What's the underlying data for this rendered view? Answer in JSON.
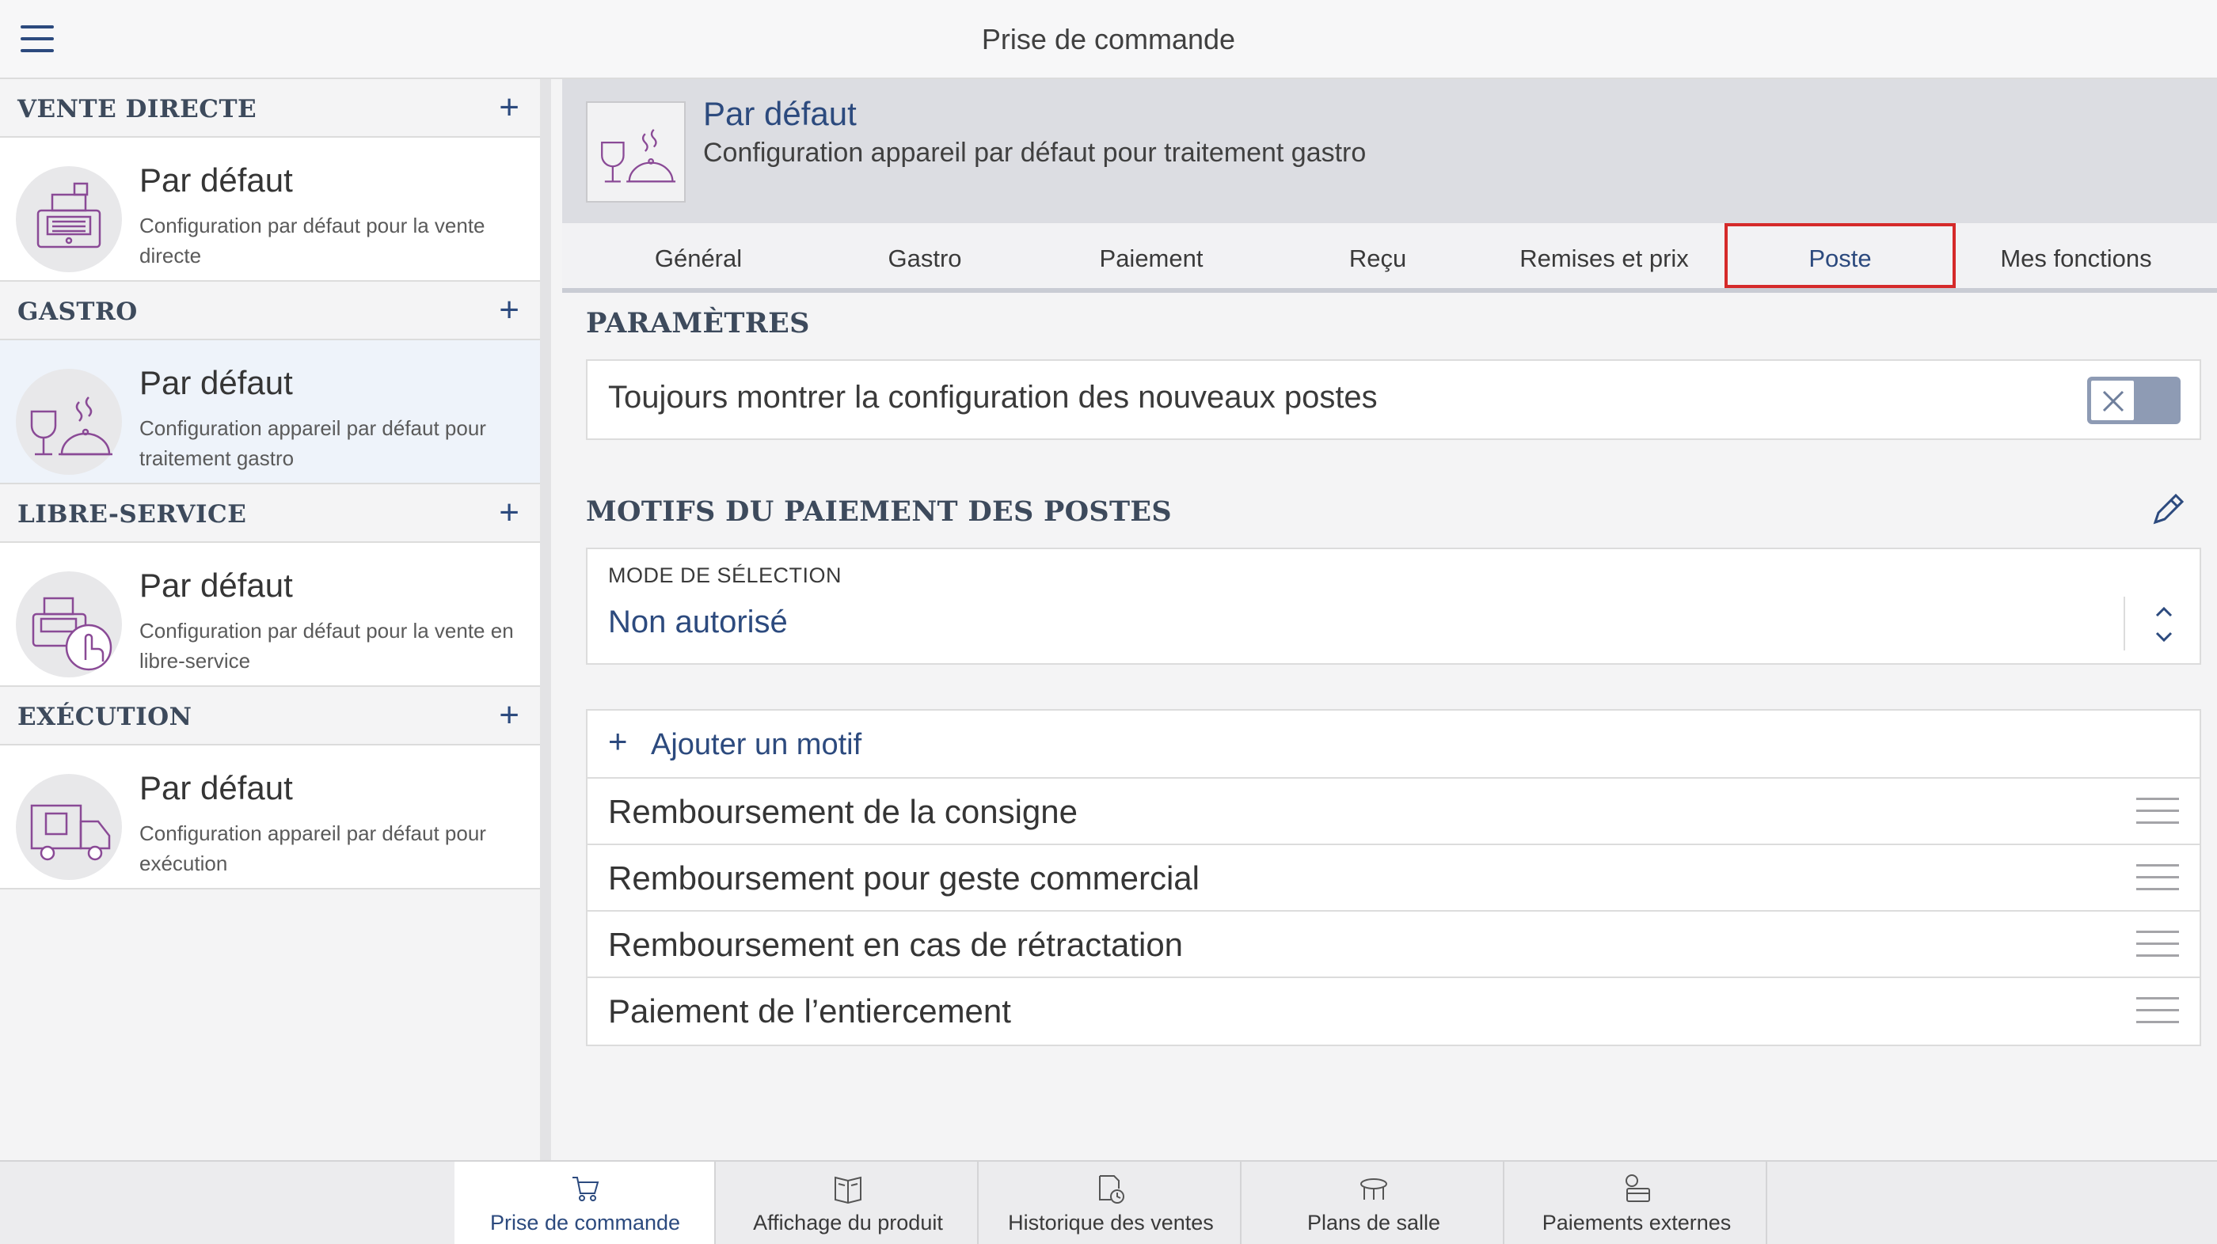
{
  "header": {
    "title": "Prise de commande"
  },
  "sidebar": {
    "sections": [
      {
        "title": "VENTE DIRECTE",
        "item_title": "Par défaut",
        "item_desc": "Configuration par défaut pour la vente directe",
        "icon": "cash-register-icon"
      },
      {
        "title": "GASTRO",
        "item_title": "Par défaut",
        "item_desc": "Configuration appareil par défaut pour traitement gastro",
        "icon": "gastro-icon",
        "selected": true
      },
      {
        "title": "LIBRE-SERVICE",
        "item_title": "Par défaut",
        "item_desc": "Configuration par défaut pour la vente en libre-service",
        "icon": "self-service-icon"
      },
      {
        "title": "EXÉCUTION",
        "item_title": "Par défaut",
        "item_desc": "Configuration appareil par défaut pour exécution",
        "icon": "delivery-truck-icon"
      }
    ],
    "add_symbol": "+"
  },
  "config": {
    "title": "Par défaut",
    "description": "Configuration appareil par défaut pour traitement gastro",
    "icon": "gastro-icon"
  },
  "tabs": [
    "Général",
    "Gastro",
    "Paiement",
    "Reçu",
    "Remises et prix",
    "Poste",
    "Mes fonctions"
  ],
  "active_tab": "Poste",
  "parametres": {
    "title": "PARAMÈTRES",
    "toggle_label": "Toujours montrer la configuration des nouveaux postes",
    "toggle_on": false
  },
  "motifs": {
    "title": "MOTIFS DU PAIEMENT DES POSTES",
    "mode_label": "MODE DE SÉLECTION",
    "mode_value": "Non autorisé",
    "add_label": "Ajouter un motif",
    "add_symbol": "+",
    "items": [
      "Remboursement de la consigne",
      "Remboursement pour geste commercial",
      "Remboursement en cas de rétractation",
      "Paiement de l’entiercement"
    ]
  },
  "bottom_tabs": [
    {
      "label": "Prise de commande",
      "icon": "cart-icon",
      "active": true
    },
    {
      "label": "Affichage du produit",
      "icon": "product-display-icon"
    },
    {
      "label": "Historique des ventes",
      "icon": "sales-history-icon"
    },
    {
      "label": "Plans de salle",
      "icon": "table-icon"
    },
    {
      "label": "Paiements externes",
      "icon": "external-payment-icon"
    }
  ],
  "colors": {
    "accent": "#2c4a7e",
    "active_tab_border": "#d52a2a",
    "icon_purple": "#8a4a96"
  }
}
